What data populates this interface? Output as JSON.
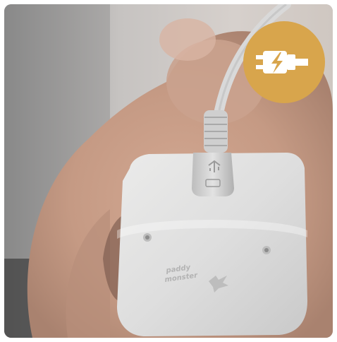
{
  "photo": {
    "subject": "usb-cable-plugged-into-grey-device-on-plush-toy"
  },
  "badge": {
    "icon": "usb-charging-icon",
    "color": "#d8a54c"
  },
  "device_logo": {
    "text": "paddy\nmonster",
    "color": "#a8a8a8"
  }
}
